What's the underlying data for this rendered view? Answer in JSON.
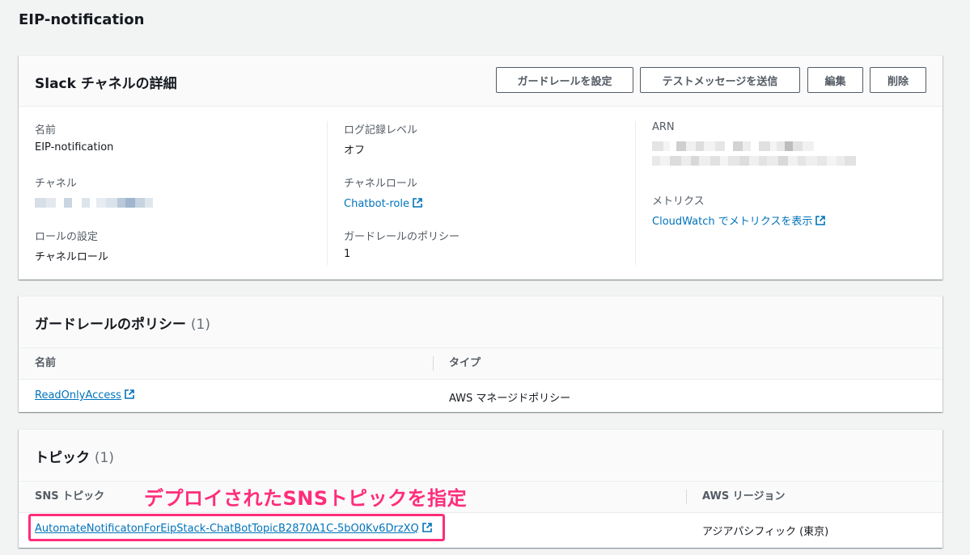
{
  "page": {
    "title": "EIP-notification"
  },
  "details": {
    "title": "Slack チャネルの詳細",
    "buttons": {
      "guardrail": "ガードレールを設定",
      "test_message": "テストメッセージを送信",
      "edit": "編集",
      "delete": "削除"
    },
    "fields": {
      "name_label": "名前",
      "name_value": "EIP-notification",
      "channel_label": "チャネル",
      "role_setting_label": "ロールの設定",
      "role_setting_value": "チャネルロール",
      "log_level_label": "ログ記録レベル",
      "log_level_value": "オフ",
      "channel_role_label": "チャネルロール",
      "channel_role_value": "Chatbot-role",
      "guardrail_policy_label": "ガードレールのポリシー",
      "guardrail_policy_value": "1",
      "arn_label": "ARN",
      "metrics_label": "メトリクス",
      "metrics_link": "CloudWatch でメトリクスを表示"
    },
    "icons": {
      "external": "external-link-icon"
    }
  },
  "guardrail_policies": {
    "title": "ガードレールのポリシー",
    "count": "(1)",
    "columns": [
      "名前",
      "タイプ"
    ],
    "rows": [
      {
        "name": "ReadOnlyAccess",
        "type": "AWS マネージドポリシー"
      }
    ]
  },
  "topics": {
    "title": "トピック",
    "count": "(1)",
    "columns": [
      "SNS トピック",
      "AWS リージョン"
    ],
    "rows": [
      {
        "topic": "AutomateNotificatonForEipStack-ChatBotTopicB2870A1C-5bO0Kv6DrzXQ",
        "region": "アジアパシフィック (東京)"
      }
    ]
  },
  "annotation": {
    "text": "デプロイされたSNSトピックを指定",
    "color": "#ff2d7a"
  },
  "colors": {
    "link": "#0073bb",
    "header_bg": "#fafafa",
    "page_bg": "#f2f3f3"
  }
}
